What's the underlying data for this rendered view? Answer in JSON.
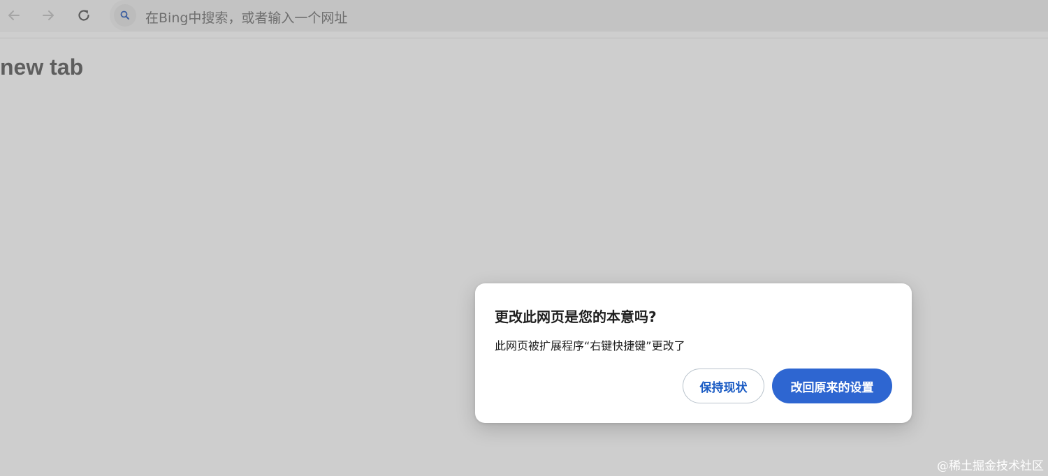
{
  "toolbar": {
    "back_icon": "arrow-left-icon",
    "forward_icon": "arrow-right-icon",
    "reload_icon": "reload-icon"
  },
  "omnibox": {
    "icon": "search-icon",
    "placeholder": "在Bing中搜索，或者输入一个网址"
  },
  "page": {
    "heading": "new tab"
  },
  "dialog": {
    "title": "更改此网页是您的本意吗?",
    "message": "此网页被扩展程序“右键快捷键”更改了",
    "keep_button_label": "保持现状",
    "restore_button_label": "改回原来的设置"
  },
  "watermark": "@稀土掘金技术社区",
  "colors": {
    "page_background": "#cecece",
    "primary_button": "#2e66d1",
    "secondary_button_text": "#1b5cc4"
  }
}
